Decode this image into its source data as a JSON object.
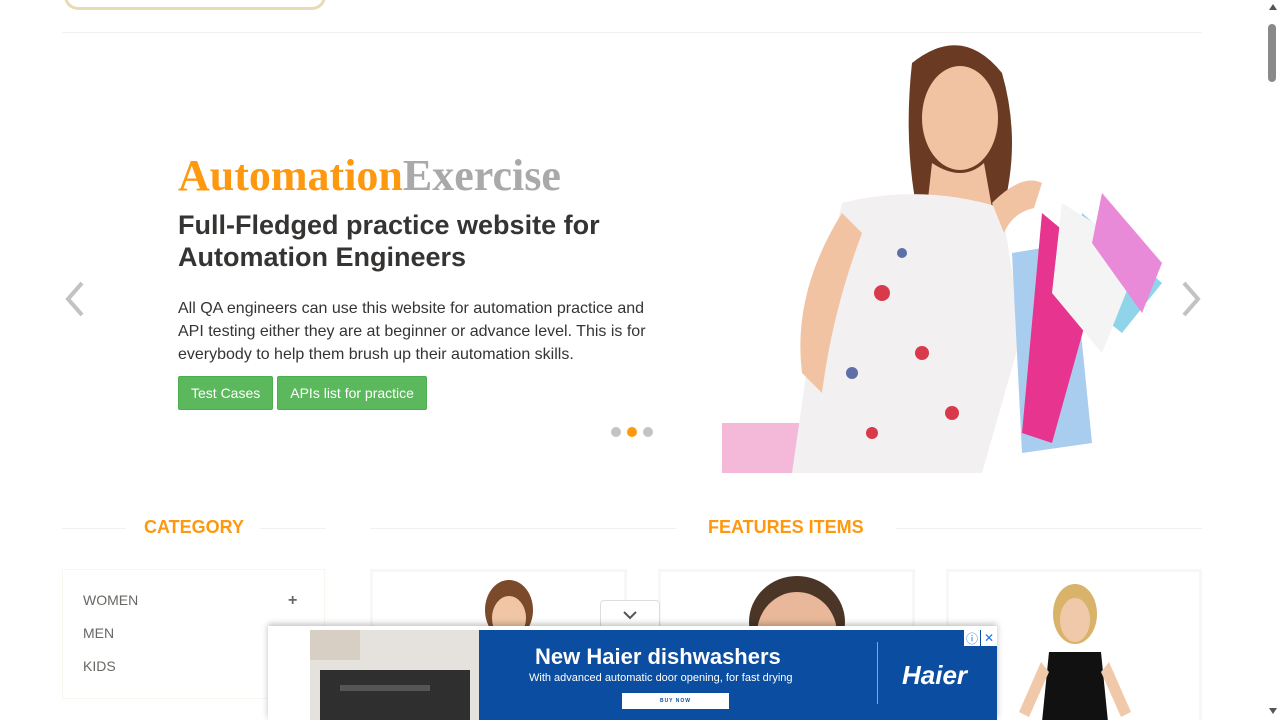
{
  "slider": {
    "brand_part1": "Automation",
    "brand_part2": "Exercise",
    "headline": "Full-Fledged practice website for Automation Engineers",
    "description": "All QA engineers can use this website for automation practice and API testing either they are at beginner or advance level. This is for everybody to help them brush up their automation skills.",
    "buttons": [
      {
        "label": "Test Cases"
      },
      {
        "label": "APIs list for practice"
      }
    ],
    "active_dot": 2,
    "dot_count": 3
  },
  "category": {
    "title": "CATEGORY",
    "items": [
      {
        "label": "WOMEN",
        "expandable": true
      },
      {
        "label": "MEN"
      },
      {
        "label": "KIDS"
      }
    ],
    "expand_glyph": "+"
  },
  "features": {
    "title": "FEATURES ITEMS"
  },
  "ad": {
    "title": "New Haier dishwashers",
    "subtitle": "With advanced automatic door opening, for fast drying",
    "cta": "BUY NOW",
    "brand": "Haier",
    "info_glyph": "ⓘ",
    "close_glyph": "✕"
  },
  "colors": {
    "accent": "#fe980f",
    "brand_gray": "#a9a9a9",
    "button_green": "#5cb85c",
    "ad_blue": "#0b4da1"
  },
  "icons": {
    "left_arrow": "chevron-left-icon",
    "right_arrow": "chevron-right-icon",
    "ad_toggle": "chevron-down-icon"
  }
}
